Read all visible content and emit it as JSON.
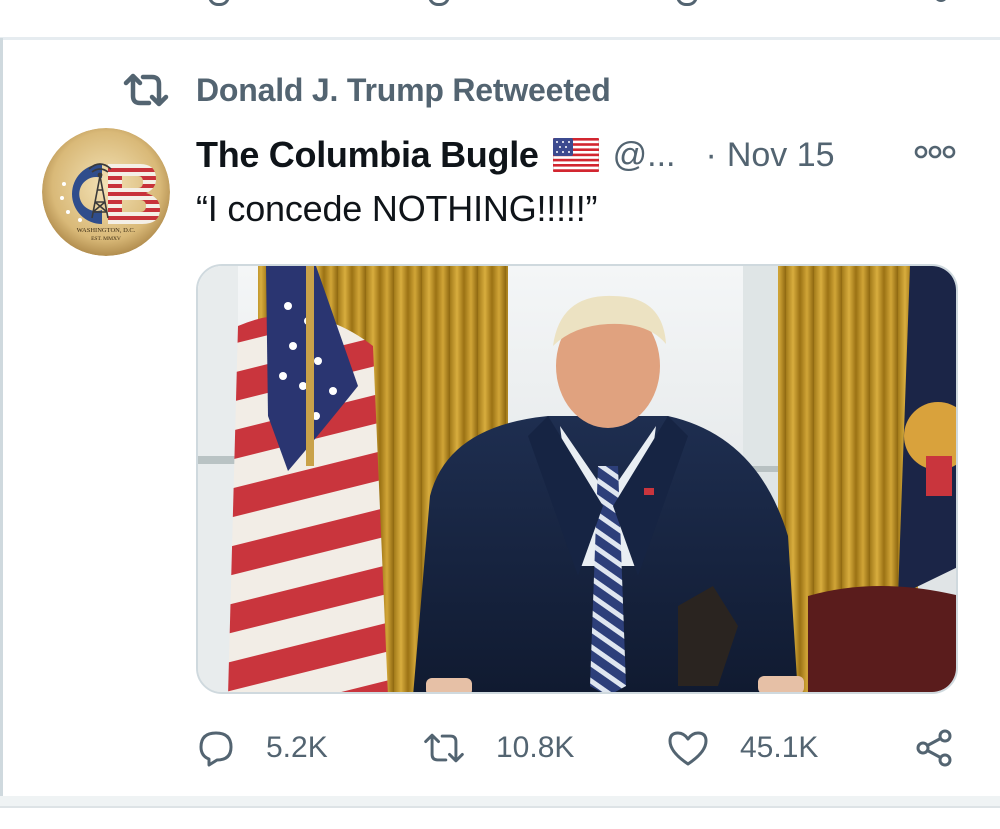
{
  "retweet_banner": {
    "text": "Donald J. Trump Retweeted",
    "icon": "retweet-icon"
  },
  "tweet": {
    "author": {
      "display_name": "The Columbia Bugle",
      "name_emoji": "us-flag-emoji",
      "handle": "@...",
      "avatar_icon": "columbia-bugle-logo",
      "avatar_logo_text": {
        "initials": "CB",
        "caption_line1": "WASHINGTON, D.C.",
        "caption_line2": "EST. MMXV"
      }
    },
    "separator": "·",
    "date": "Nov 15",
    "text": "“I concede NOTHING!!!!!”",
    "media_icon": "photo-oval-office"
  },
  "actions": {
    "reply_count": "5.2K",
    "retweet_count": "10.8K",
    "like_count": "45.1K",
    "icons": {
      "reply": "reply-icon",
      "retweet": "retweet-icon",
      "like": "heart-icon",
      "share": "share-icon",
      "more": "more-options-icon"
    }
  },
  "colors": {
    "secondary_text": "#536471",
    "primary_text": "#0f1419",
    "divider": "#e6ecf0"
  }
}
